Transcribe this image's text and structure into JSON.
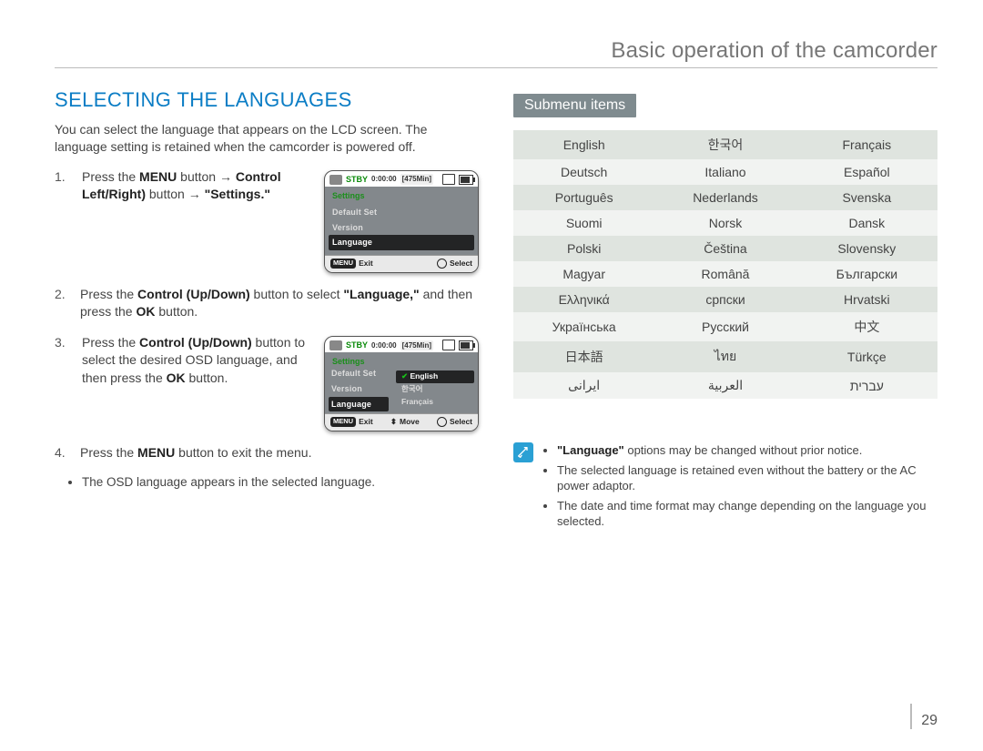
{
  "chapter_title": "Basic operation of the camcorder",
  "section_title": "SELECTING THE LANGUAGES",
  "intro": "You can select the language that appears on the LCD screen. The language setting is retained when the camcorder is powered off.",
  "steps": [
    {
      "num": "1.",
      "html": "Press the <b>MENU</b> button → <b>Control Left/Right)</b> button → <b>\"Settings.\"</b>"
    },
    {
      "num": "2.",
      "html": "Press the <b>Control (Up/Down)</b> button to select <b>\"Language,\"</b> and then press the <b>OK</b> button."
    },
    {
      "num": "3.",
      "html": "Press the <b>Control (Up/Down)</b> button to select the desired OSD language, and then press the <b>OK</b> button."
    },
    {
      "num": "4.",
      "html": "Press the <b>MENU</b> button to exit the menu."
    }
  ],
  "step_bullet": "The OSD language appears in the selected language.",
  "osd": {
    "stby": "STBY",
    "time": "0:00:00",
    "remain": "[475Min]",
    "settings_label": "Settings",
    "items1": [
      "Default Set",
      "Version",
      "Language"
    ],
    "bottom1": {
      "menu": "MENU",
      "exit": "Exit",
      "select": "Select"
    },
    "items2_left": [
      "Default Set",
      "Version",
      "Language"
    ],
    "items2_right": [
      "English",
      "한국어",
      "Français"
    ],
    "bottom2": {
      "menu": "MENU",
      "exit": "Exit",
      "move": "Move",
      "select": "Select"
    }
  },
  "submenu_label": "Submenu items",
  "languages": [
    [
      "English",
      "한국어",
      "Français"
    ],
    [
      "Deutsch",
      "Italiano",
      "Español"
    ],
    [
      "Português",
      "Nederlands",
      "Svenska"
    ],
    [
      "Suomi",
      "Norsk",
      "Dansk"
    ],
    [
      "Polski",
      "Čeština",
      "Slovensky"
    ],
    [
      "Magyar",
      "Română",
      "Български"
    ],
    [
      "Ελληνικά",
      "српски",
      "Hrvatski"
    ],
    [
      "Українська",
      "Русский",
      "中文"
    ],
    [
      "日本語",
      "ไทย",
      "Türkçe"
    ],
    [
      "ایرانی",
      "العربية",
      "עברית"
    ]
  ],
  "notes": [
    "<b>\"Language\"</b> options may be changed without prior notice.",
    "The selected language is retained even without the battery or the AC power adaptor.",
    "The date and time format may change depending on the language you selected."
  ],
  "page_number": "29"
}
